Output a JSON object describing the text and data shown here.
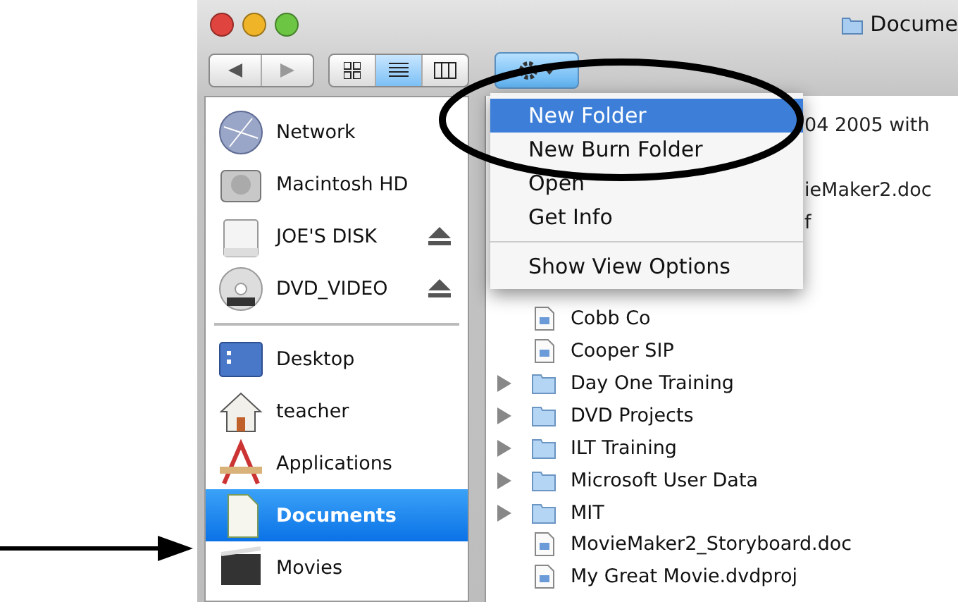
{
  "window": {
    "title": "Docume"
  },
  "toolbar": {
    "view_buttons": [
      {
        "selected": false
      },
      {
        "selected": true
      },
      {
        "selected": false
      }
    ]
  },
  "sidebar": {
    "sections": [
      {
        "items": [
          {
            "label": "Network",
            "eject": false,
            "selected": false
          },
          {
            "label": "Macintosh HD",
            "eject": false,
            "selected": false
          },
          {
            "label": "JOE'S DISK",
            "eject": true,
            "selected": false
          },
          {
            "label": "DVD_VIDEO",
            "eject": true,
            "selected": false
          }
        ]
      },
      {
        "items": [
          {
            "label": "Desktop",
            "eject": false,
            "selected": false
          },
          {
            "label": "teacher",
            "eject": false,
            "selected": false
          },
          {
            "label": "Applications",
            "eject": false,
            "selected": false
          },
          {
            "label": "Documents",
            "eject": false,
            "selected": true
          },
          {
            "label": "Movies",
            "eject": false,
            "selected": false
          }
        ]
      }
    ]
  },
  "files": {
    "rows": [
      {
        "kind": "covered",
        "name": "04  2005 with"
      },
      {
        "kind": "covered"
      },
      {
        "kind": "covered",
        "name": "ieMaker2.doc"
      },
      {
        "kind": "covered",
        "name": "f"
      },
      {
        "kind": "covered"
      },
      {
        "kind": "covered"
      },
      {
        "kind": "file",
        "name": "Cobb Co"
      },
      {
        "kind": "file",
        "name": "Cooper SIP"
      },
      {
        "kind": "folder",
        "name": "Day One Training"
      },
      {
        "kind": "folder",
        "name": "DVD Projects"
      },
      {
        "kind": "folder",
        "name": "ILT Training"
      },
      {
        "kind": "folder",
        "name": "Microsoft User Data"
      },
      {
        "kind": "folder",
        "name": "MIT"
      },
      {
        "kind": "file",
        "name": "MovieMaker2_Storyboard.doc"
      },
      {
        "kind": "file",
        "name": "My Great Movie.dvdproj"
      }
    ]
  },
  "action_menu": {
    "groups": [
      {
        "items": [
          {
            "label": "New Folder",
            "selected": true
          },
          {
            "label": "New Burn Folder",
            "selected": false
          },
          {
            "label": "Open",
            "selected": false
          },
          {
            "label": "Get Info",
            "selected": false
          }
        ]
      },
      {
        "items": [
          {
            "label": "Show View Options",
            "selected": false
          }
        ]
      }
    ]
  }
}
